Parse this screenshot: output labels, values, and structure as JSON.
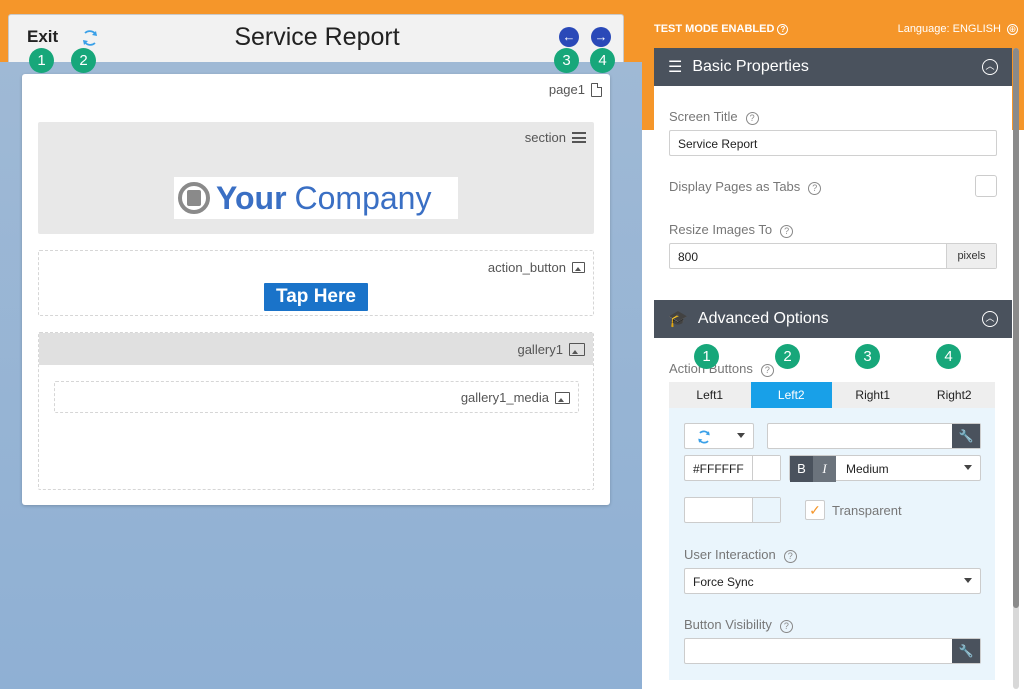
{
  "preview": {
    "exit_label": "Exit",
    "title": "Service Report",
    "badges": [
      "1",
      "2",
      "3",
      "4"
    ],
    "page_label": "page1",
    "section_label": "section",
    "logo": {
      "your": "Your",
      "company": "Company"
    },
    "action_button_label": "action_button",
    "tap_here_label": "Tap Here",
    "gallery_label": "gallery1",
    "gallery_media_label": "gallery1_media"
  },
  "topbar": {
    "test_mode": "TEST MODE ENABLED",
    "language": "Language: ENGLISH"
  },
  "basic": {
    "heading": "Basic Properties",
    "screen_title_label": "Screen Title",
    "screen_title_value": "Service Report",
    "display_tabs_label": "Display Pages as Tabs",
    "resize_label": "Resize Images To",
    "resize_value": "800",
    "resize_unit": "pixels"
  },
  "advanced": {
    "heading": "Advanced Options",
    "action_buttons_label": "Action Buttons",
    "badges": [
      "1",
      "2",
      "3",
      "4"
    ],
    "tabs": [
      {
        "label": "Left1",
        "active": false
      },
      {
        "label": "Left2",
        "active": true
      },
      {
        "label": "Right1",
        "active": false
      },
      {
        "label": "Right2",
        "active": false
      }
    ],
    "color_value": "#FFFFFF",
    "bold_label": "B",
    "italic_label": "I",
    "size_value": "Medium",
    "transparent_label": "Transparent",
    "user_interaction_label": "User Interaction",
    "user_interaction_value": "Force Sync",
    "button_visibility_label": "Button Visibility"
  },
  "colors": {
    "orange": "#f5962a",
    "dark_header": "#4a525d",
    "badge_green": "#17a77a",
    "active_tab": "#18a0e8",
    "tap_button": "#1a73c9"
  }
}
